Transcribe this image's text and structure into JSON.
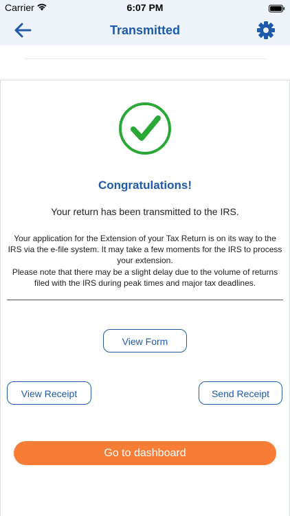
{
  "status_bar": {
    "carrier": "Carrier",
    "time": "6:07 PM"
  },
  "nav": {
    "title": "Transmitted",
    "back_icon": "arrow-left-icon",
    "settings_icon": "gear-icon"
  },
  "main": {
    "heading": "Congratulations!",
    "transmitted_message": "Your return has been transmitted to the IRS.",
    "paragraph_1": "Your application for the Extension of your Tax Return is on its way to the IRS via the e-file system. It may take a few moments for the IRS to process your extension.",
    "paragraph_2": "Please note that there may be a slight delay due to the volume of returns filed with the IRS during peak times and major tax deadlines."
  },
  "buttons": {
    "view_form": "View Form",
    "view_receipt": "View Receipt",
    "send_receipt": "Send Receipt",
    "go_to_dashboard": "Go to dashboard"
  },
  "colors": {
    "accent": "#1f5aa8",
    "success": "#2aa836",
    "cta": "#f77c36"
  }
}
